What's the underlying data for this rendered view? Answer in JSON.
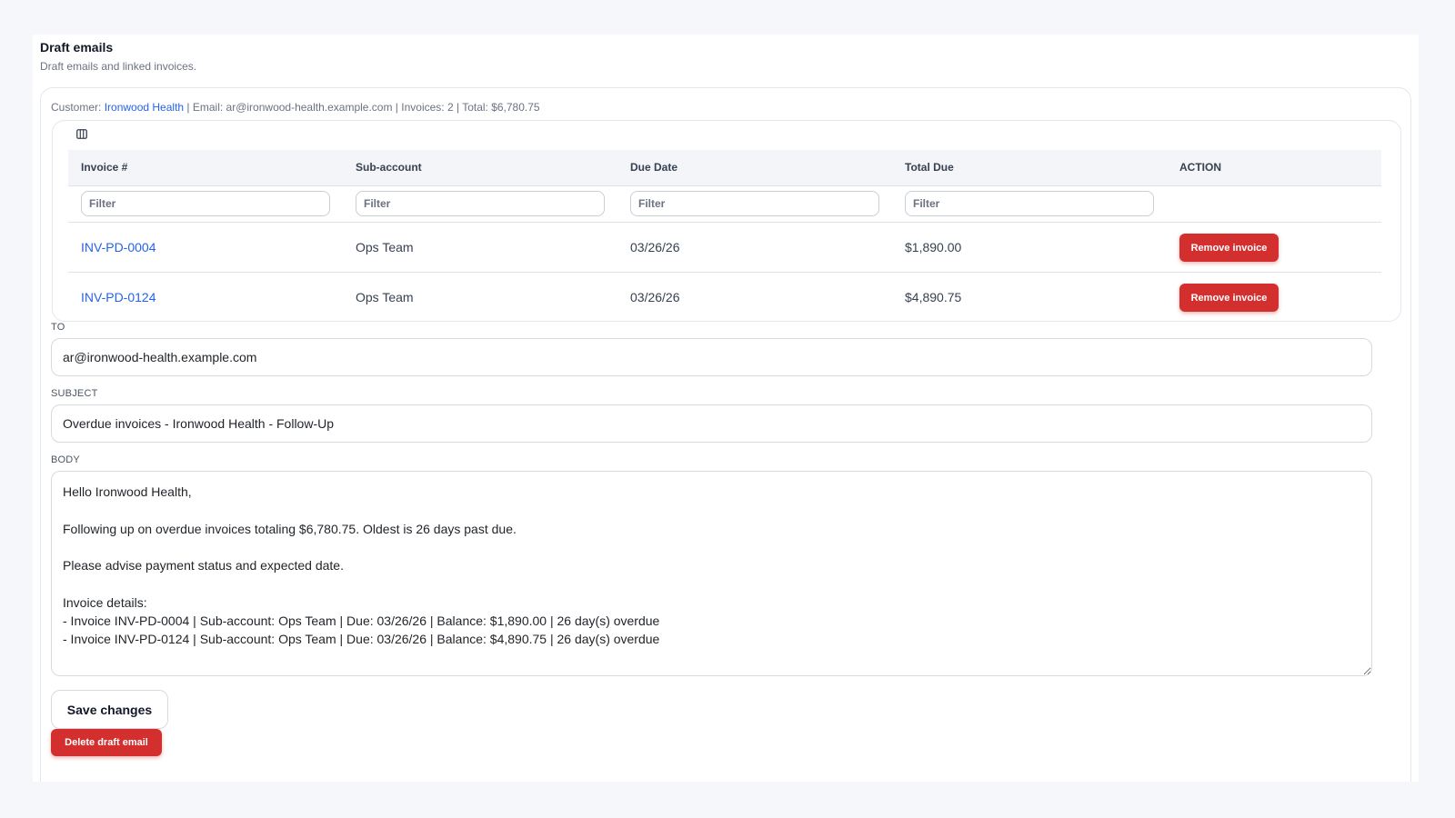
{
  "section": {
    "title": "Draft emails",
    "subtitle": "Draft emails and linked invoices."
  },
  "customer_meta": {
    "customer_label": "Customer: ",
    "customer_name": "Ironwood Health",
    "rest": " | Email: ar@ironwood-health.example.com | Invoices: 2 | Total: $6,780.75"
  },
  "table": {
    "columns_icon": "columns-icon",
    "headers": [
      "Invoice #",
      "Sub-account",
      "Due Date",
      "Total Due",
      "ACTION"
    ],
    "filter_placeholder": "Filter",
    "rows": [
      {
        "invoice": "INV-PD-0004",
        "sub_account": "Ops Team",
        "due_date": "03/26/26",
        "total_due": "$1,890.00",
        "action_label": "Remove invoice"
      },
      {
        "invoice": "INV-PD-0124",
        "sub_account": "Ops Team",
        "due_date": "03/26/26",
        "total_due": "$4,890.75",
        "action_label": "Remove invoice"
      }
    ]
  },
  "email": {
    "to_label": "TO",
    "to_value": "ar@ironwood-health.example.com",
    "subject_label": "SUBJECT",
    "subject_value": "Overdue invoices - Ironwood Health - Follow-Up",
    "body_label": "BODY",
    "body_value": "Hello Ironwood Health,\n\nFollowing up on overdue invoices totaling $6,780.75. Oldest is 26 days past due.\n\nPlease advise payment status and expected date.\n\nInvoice details:\n- Invoice INV-PD-0004 | Sub-account: Ops Team | Due: 03/26/26 | Balance: $1,890.00 | 26 day(s) overdue\n- Invoice INV-PD-0124 | Sub-account: Ops Team | Due: 03/26/26 | Balance: $4,890.75 | 26 day(s) overdue"
  },
  "buttons": {
    "save_label": "Save changes",
    "delete_label": "Delete draft email"
  },
  "colors": {
    "link": "#2563eb",
    "danger": "#d32f2f",
    "background": "#f5f7fb"
  }
}
